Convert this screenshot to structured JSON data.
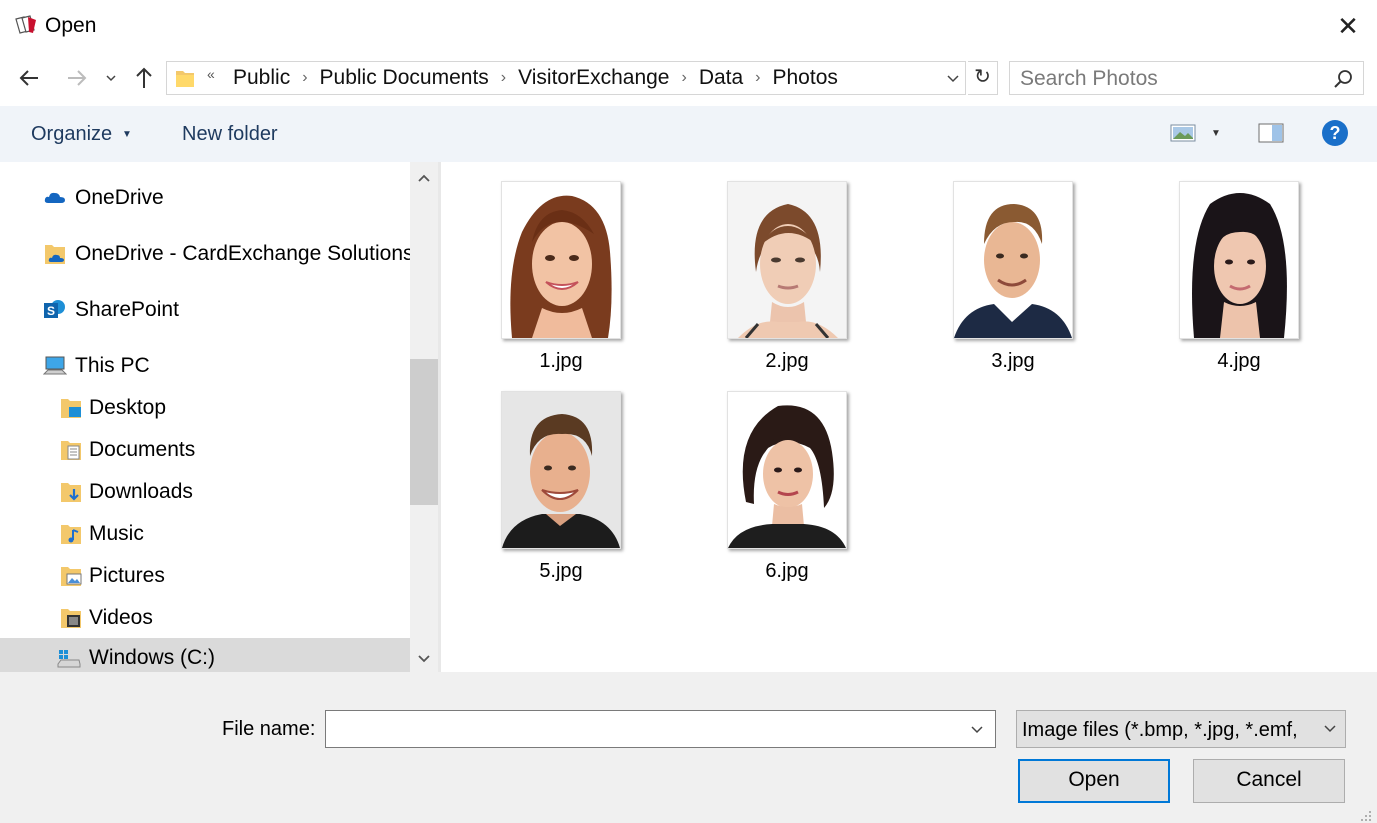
{
  "window": {
    "title": "Open"
  },
  "address": {
    "more": "«",
    "crumbs": [
      "Public",
      "Public Documents",
      "VisitorExchange",
      "Data",
      "Photos"
    ]
  },
  "search": {
    "placeholder": "Search Photos"
  },
  "toolbar": {
    "organize": "Organize",
    "new_folder": "New folder"
  },
  "nav": {
    "items": [
      {
        "label": "OneDrive",
        "icon": "cloud-icon"
      },
      {
        "label": "OneDrive - CardExchange Solutions",
        "icon": "folder-cloud-icon"
      },
      {
        "label": "SharePoint",
        "icon": "sharepoint-icon"
      },
      {
        "label": "This PC",
        "icon": "computer-icon"
      },
      {
        "label": "Desktop",
        "icon": "desktop-folder-icon"
      },
      {
        "label": "Documents",
        "icon": "documents-folder-icon"
      },
      {
        "label": "Downloads",
        "icon": "downloads-folder-icon"
      },
      {
        "label": "Music",
        "icon": "music-folder-icon"
      },
      {
        "label": "Pictures",
        "icon": "pictures-folder-icon"
      },
      {
        "label": "Videos",
        "icon": "videos-folder-icon"
      },
      {
        "label": "Windows (C:)",
        "icon": "drive-icon"
      }
    ],
    "selected_index": 10
  },
  "files": [
    {
      "name": "1.jpg"
    },
    {
      "name": "2.jpg"
    },
    {
      "name": "3.jpg"
    },
    {
      "name": "4.jpg"
    },
    {
      "name": "5.jpg"
    },
    {
      "name": "6.jpg"
    }
  ],
  "bottom": {
    "file_name_label": "File name:",
    "file_name_value": "",
    "filter": "Image files (*.bmp, *.jpg, *.emf,",
    "open": "Open",
    "cancel": "Cancel"
  },
  "colors": {
    "accent": "#0078d7",
    "link_text": "#1e3a5f"
  }
}
